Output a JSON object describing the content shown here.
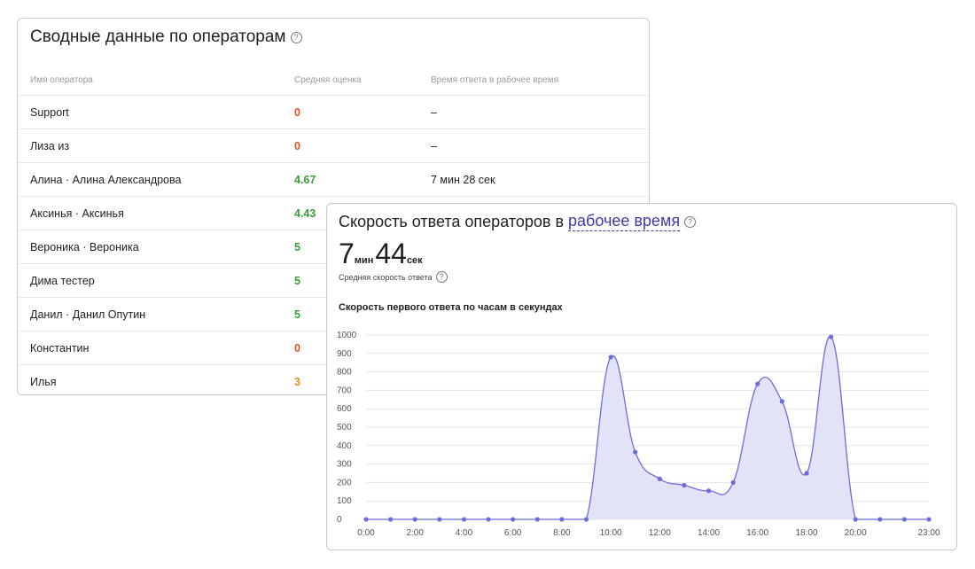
{
  "operators": {
    "title": "Сводные данные по операторам",
    "help_icon": "?",
    "columns": [
      "Имя оператора",
      "Средняя оценка",
      "Время ответа в рабочее время"
    ],
    "rows": [
      {
        "name": "Support",
        "score": "0",
        "time": "–"
      },
      {
        "name": "Лиза из",
        "score": "0",
        "time": "–"
      },
      {
        "name": "Алина · Алина Александрова",
        "score": "4.67",
        "time": "7 мин 28 сек"
      },
      {
        "name": "Аксинья · Аксинья",
        "score": "4.43",
        "time": ""
      },
      {
        "name": "Вероника · Вероника",
        "score": "5",
        "time": ""
      },
      {
        "name": "Дима тестер",
        "score": "5",
        "time": ""
      },
      {
        "name": "Данил · Данил Опутин",
        "score": "5",
        "time": ""
      },
      {
        "name": "Константин",
        "score": "0",
        "time": ""
      },
      {
        "name": "Илья",
        "score": "3",
        "time": ""
      }
    ],
    "score_colors": {
      "zero": "#d9531e",
      "high": "#3a9d3a",
      "mid": "#e0961c"
    }
  },
  "speed": {
    "title_prefix": "Скорость ответа операторов в",
    "title_link": "рабочее время",
    "help_icon": "?",
    "big_min": "7",
    "min_unit": "мин",
    "big_sec": "44",
    "sec_unit": "сек",
    "avg_label": "Средняя скорость ответа",
    "chart_label": "Скорость первого ответа по часам в секундах"
  },
  "chart_data": {
    "type": "area",
    "x": [
      0,
      1,
      2,
      3,
      4,
      5,
      6,
      7,
      8,
      9,
      10,
      11,
      12,
      13,
      14,
      15,
      16,
      17,
      18,
      19,
      20,
      21,
      22,
      23
    ],
    "values": [
      0,
      0,
      0,
      0,
      0,
      0,
      0,
      0,
      0,
      0,
      880,
      365,
      220,
      185,
      155,
      200,
      735,
      640,
      250,
      990,
      0,
      0,
      0,
      0
    ],
    "xtick_labels": [
      "0:00",
      "2:00",
      "4:00",
      "6:00",
      "8:00",
      "10:00",
      "12:00",
      "14:00",
      "16:00",
      "18:00",
      "20:00",
      "23:00"
    ],
    "xtick_positions": [
      0,
      2,
      4,
      6,
      8,
      10,
      12,
      14,
      16,
      18,
      20,
      23
    ],
    "yticks": [
      0,
      100,
      200,
      300,
      400,
      500,
      600,
      700,
      800,
      900,
      1000
    ],
    "ylim": [
      0,
      1000
    ],
    "xlim": [
      0,
      23
    ],
    "grid": true,
    "color": "#6c6cdb",
    "fill": "#e3e3f7"
  }
}
